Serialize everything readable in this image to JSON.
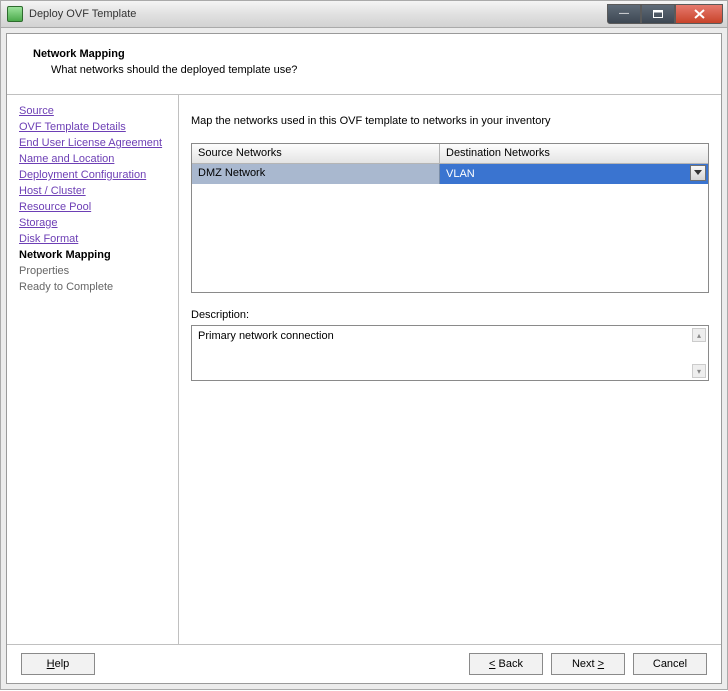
{
  "window": {
    "title": "Deploy OVF Template"
  },
  "header": {
    "heading": "Network Mapping",
    "sub": "What networks should the deployed template use?"
  },
  "steps": {
    "items": [
      {
        "label": "Source",
        "state": "done"
      },
      {
        "label": "OVF Template Details",
        "state": "done"
      },
      {
        "label": "End User License Agreement",
        "state": "done"
      },
      {
        "label": "Name and Location",
        "state": "done"
      },
      {
        "label": "Deployment Configuration",
        "state": "done"
      },
      {
        "label": "Host / Cluster",
        "state": "done"
      },
      {
        "label": "Resource Pool",
        "state": "done"
      },
      {
        "label": "Storage",
        "state": "done"
      },
      {
        "label": "Disk Format",
        "state": "done"
      },
      {
        "label": "Network Mapping",
        "state": "current"
      },
      {
        "label": "Properties",
        "state": "pending"
      },
      {
        "label": "Ready to Complete",
        "state": "pending"
      }
    ]
  },
  "main": {
    "instruction": "Map the networks used in this OVF template to networks in your inventory",
    "columns": {
      "source": "Source Networks",
      "dest": "Destination Networks"
    },
    "row": {
      "source": "DMZ Network",
      "dest": "VLAN"
    },
    "desc_label": "Description:",
    "desc_value": "Primary network connection"
  },
  "footer": {
    "help": "Help",
    "back": "Back",
    "back_accel": "<",
    "next": "Next",
    "next_accel": ">",
    "cancel": "Cancel"
  }
}
